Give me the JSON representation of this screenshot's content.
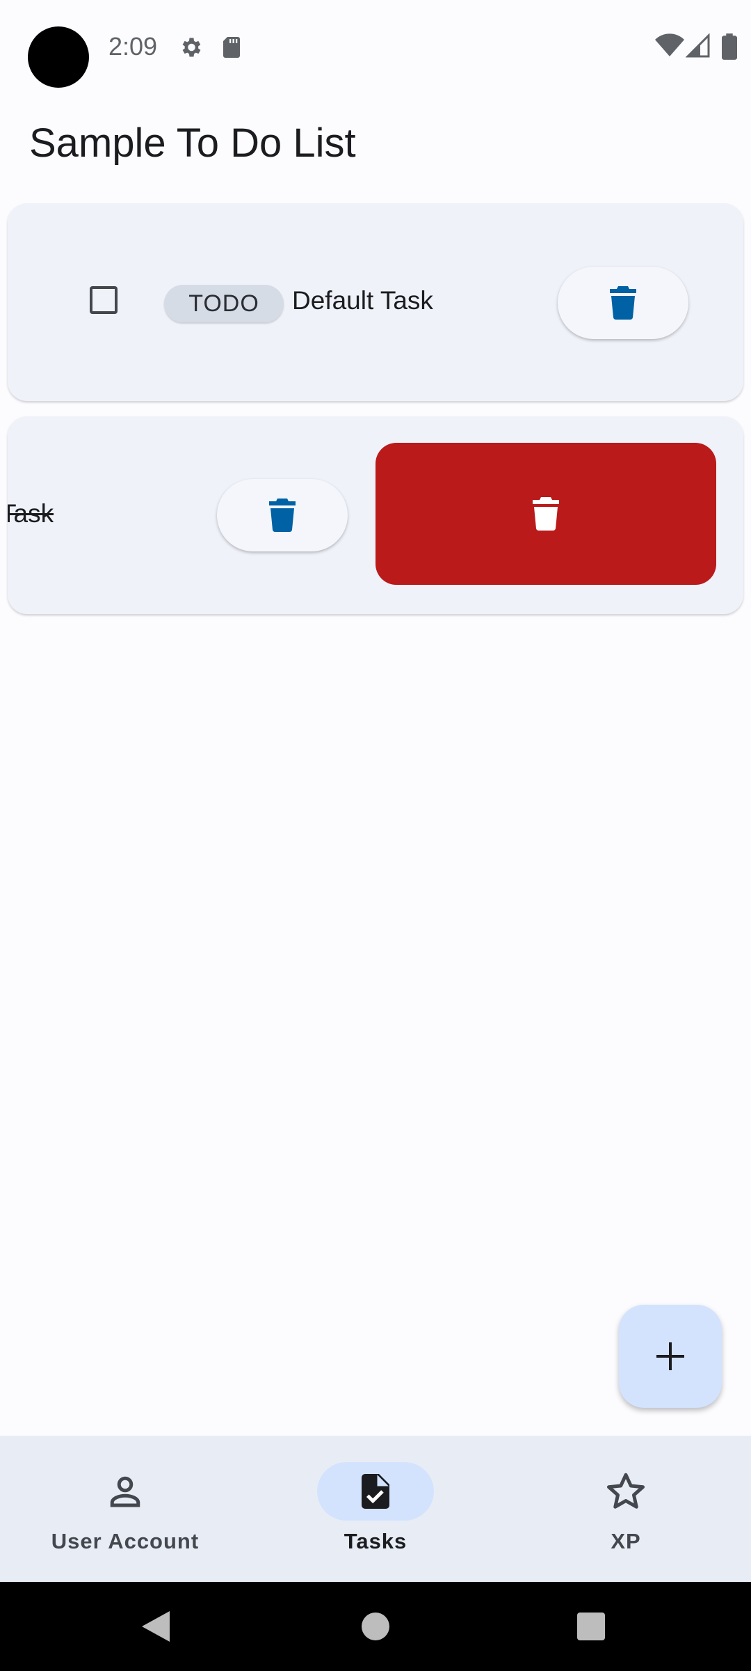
{
  "status_bar": {
    "time": "2:09",
    "left_icons": [
      "settings-icon",
      "sd-card-icon"
    ],
    "right_icons": [
      "wifi-icon",
      "cell-signal-icon",
      "battery-icon"
    ]
  },
  "page": {
    "title": "Sample To Do List"
  },
  "tasks": [
    {
      "status_chip": "TODO",
      "name": "Default Task",
      "completed": false,
      "delete_icon": "trash-icon"
    },
    {
      "name": "Task",
      "completed": true,
      "swiped": true,
      "delete_icon": "trash-icon",
      "swipe_action_icon": "trash-icon",
      "swipe_action_color": "#ba1a1a"
    }
  ],
  "fab": {
    "icon": "plus-icon"
  },
  "bottom_nav": {
    "items": [
      {
        "label": "User Account",
        "icon": "person-icon",
        "active": false
      },
      {
        "label": "Tasks",
        "icon": "task-icon",
        "active": true
      },
      {
        "label": "XP",
        "icon": "star-icon",
        "active": false
      }
    ]
  },
  "system_nav": [
    "back-icon",
    "home-icon",
    "recents-icon"
  ],
  "colors": {
    "background": "#fcfcff",
    "card": "#eff2f9",
    "accent_blue": "#0061a4",
    "delete_red": "#ba1a1a",
    "fab": "#d3e3fd",
    "nav_bar": "#e8edf5"
  }
}
